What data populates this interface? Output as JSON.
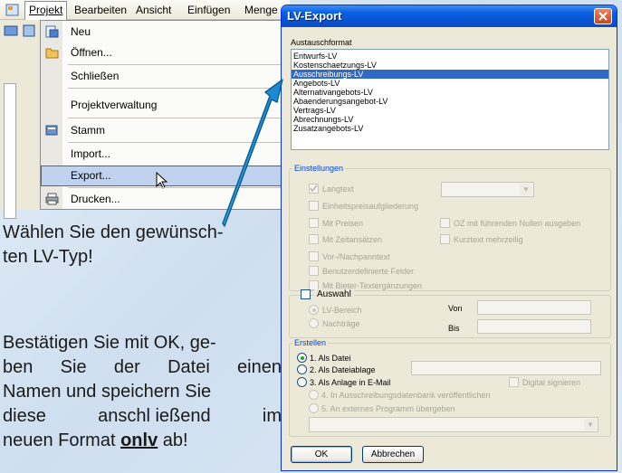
{
  "menubar": {
    "items": [
      "Projekt",
      "Bearbeiten",
      "Ansicht",
      "Einfügen",
      "Menge"
    ]
  },
  "menu": {
    "items": [
      {
        "label": "Neu",
        "icon": "new-doc-icon"
      },
      {
        "label": "Öffnen...",
        "icon": "open-folder-icon"
      },
      {
        "label": "Schließen",
        "icon": ""
      },
      {
        "label": "Projektverwaltung",
        "icon": ""
      },
      {
        "label": "Stamm",
        "icon": "master-data-icon"
      },
      {
        "label": "Import...",
        "icon": ""
      },
      {
        "label": "Export...",
        "icon": "",
        "highlighted": true
      },
      {
        "label": "Drucken...",
        "icon": "printer-icon"
      }
    ]
  },
  "instructions": {
    "line1": "Wählen Sie den gewünsch-",
    "line2": "ten LV-Typ!",
    "para2_line1": "Bestätigen Sie mit OK, ge-",
    "para2_line2": "ben Sie der Datei einen",
    "para2_line3": "Namen und speichern Sie",
    "para2_line4_a": "diese",
    "para2_line4_b": "anschl ießend",
    "para2_line4_c": "im",
    "para2_line5_a": "neuen Format ",
    "para2_line5_b": "onlv",
    "para2_line5_c": " ab!"
  },
  "dialog": {
    "title": "LV-Export",
    "austauschformat_label": "Austauschformat",
    "formats": [
      "Entwurfs-LV",
      "Kostenschaetzungs-LV",
      "Ausschreibungs-LV",
      "Angebots-LV",
      "Alternativangebots-LV",
      "Abaenderungsangebot-LV",
      "Vertrags-LV",
      "Abrechnungs-LV",
      "Zusatzangebots-LV"
    ],
    "selected_format": "Ausschreibungs-LV",
    "einstellungen": {
      "title": "Einstellungen",
      "langtext": "Langtext",
      "einheitspreis": "Einheitspreisaufgliederung",
      "mit_preisen": "Mit Preisen",
      "oz_nullen": "OZ mit führenden Nullen ausgeben",
      "mit_zeitansaetzen": "Mit Zeitansätzen",
      "kurztext_mehrzeilig": "Kurztext mehrzeilig",
      "vor_nachpanntext": "Vor-/Nachpanntext",
      "benutzerdefinierte": "Benutzerdefinierte Felder",
      "mit_bieter": "Mit Bieter-Textergänzungen"
    },
    "auswahl": {
      "title": "Auswahl",
      "lv_bereich": "LV-Bereich",
      "nachtraege": "Nachträge",
      "von": "Von",
      "bis": "Bis"
    },
    "erstellen": {
      "title": "Erstellen",
      "opt1": "1. Als Datei",
      "opt2": "2. Als Dateiablage",
      "opt3": "3. Als Anlage in E-Mail",
      "digital_signieren": "Digital signieren",
      "opt4": "4. In Ausschreibungsdatenbank veröffentlichen",
      "opt5": "5. An externes Programm übergeben"
    },
    "ok_label": "OK",
    "cancel_label": "Abbrechen"
  },
  "colors": {
    "title_bar": "#0a5fe0",
    "selection": "#316ac5",
    "arrow": "#2aa8e8",
    "group_title": "#0046d5"
  }
}
